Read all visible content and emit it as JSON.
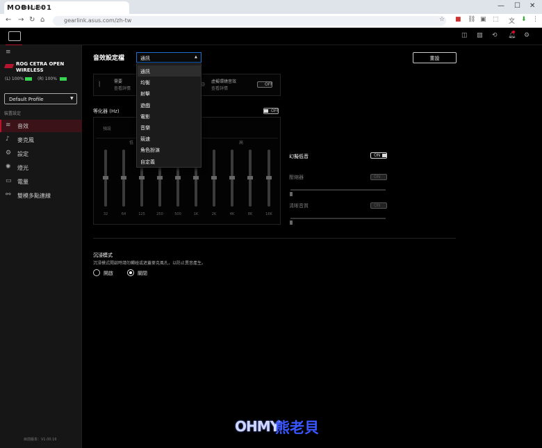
{
  "browser": {
    "tab_title": "Gear Link",
    "url": "gearlink.asus.com/zh-tw",
    "watermark": "MOBILE01"
  },
  "app": {
    "device_name_line1": "ROG CETRA OPEN",
    "device_name_line2": "WIRELESS",
    "battery_left": "(L) 100%",
    "battery_right": "(R) 100%",
    "profile_select": "Default Profile",
    "section_label": "裝置設定",
    "sidebar_items": [
      "音效",
      "麥克風",
      "設定",
      "燈光",
      "電量",
      "雙模多點連線"
    ],
    "version": "目前版本：V1.00.16",
    "colors": {
      "accent": "#b5152d",
      "battery": "#39d353"
    }
  },
  "main": {
    "sound_profile_label": "音效設定檔",
    "sound_profile_value": "通訊",
    "reset_button": "重設",
    "card_item1_title": "需要",
    "card_item1_sub": "查看詳情",
    "card_item2_title": "虛擬環繞音效",
    "card_item2_sub": "查看詳情",
    "card_toggle": "OFF",
    "eq_label": "等化器 (Hz)",
    "eq_toggle": "OFF",
    "eq_preset_label": "預設",
    "eq_low": "低",
    "eq_high": "高",
    "eq_freqs": [
      "32",
      "64",
      "125",
      "250",
      "500",
      "1K",
      "2K",
      "4K",
      "8K",
      "16K"
    ],
    "bass_label": "幻擬低音",
    "bass_toggle": "ON",
    "compressor_label": "壓縮器",
    "compressor_toggle": "ON",
    "clarity_label": "清晰音質",
    "clarity_toggle": "ON",
    "immersive_title": "沉浸模式",
    "immersive_desc": "沉浸模式開啟時請勿觸碰或遮蓋麥克風孔，以防止異音產生。",
    "radio_on": "開啟",
    "radio_off": "關閉"
  },
  "dropdown": {
    "options": [
      "通訊",
      "均衡",
      "射擊",
      "遊戲",
      "電影",
      "音樂",
      "競速",
      "角色扮演",
      "自定義"
    ]
  },
  "footer_logo": {
    "text1": "OHMY",
    "text2": "熊老貝"
  }
}
